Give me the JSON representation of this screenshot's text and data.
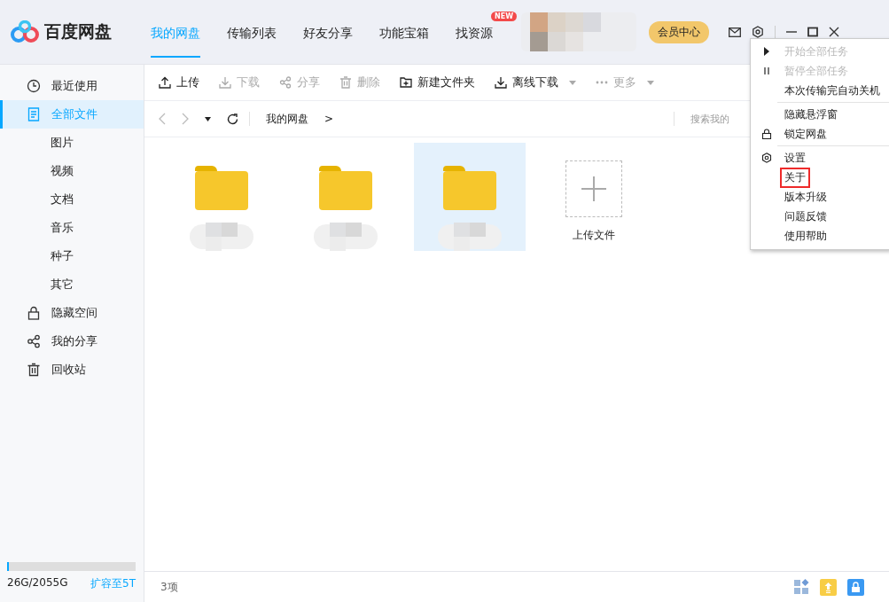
{
  "app": {
    "name": "百度网盘"
  },
  "nav_tabs": [
    {
      "label": "我的网盘",
      "selected": true
    },
    {
      "label": "传输列表",
      "selected": false
    },
    {
      "label": "好友分享",
      "selected": false
    },
    {
      "label": "功能宝箱",
      "selected": false
    },
    {
      "label": "找资源",
      "selected": false,
      "badge": "NEW"
    }
  ],
  "header": {
    "vip": "会员中心"
  },
  "sidebar": {
    "items": [
      {
        "label": "最近使用",
        "kind": "clock",
        "selected": false
      },
      {
        "label": "全部文件",
        "kind": "file",
        "selected": true,
        "children": [
          {
            "label": "图片",
            "selected": false
          },
          {
            "label": "视频",
            "selected": false
          },
          {
            "label": "文档",
            "selected": false
          },
          {
            "label": "音乐",
            "selected": false
          },
          {
            "label": "种子",
            "selected": false
          },
          {
            "label": "其它",
            "selected": false
          }
        ]
      },
      {
        "label": "隐藏空间",
        "kind": "lock",
        "selected": false
      },
      {
        "label": "我的分享",
        "kind": "share",
        "selected": false
      },
      {
        "label": "回收站",
        "kind": "trash",
        "selected": false
      }
    ]
  },
  "storage": {
    "level": 0.013,
    "usage": "26G/2055G",
    "expand": "扩容至5T"
  },
  "toolbar": [
    {
      "label": "上传",
      "kind": "upload",
      "disabled": false,
      "dropdown": false
    },
    {
      "label": "下载",
      "kind": "download",
      "disabled": true,
      "dropdown": false
    },
    {
      "label": "分享",
      "kind": "share",
      "disabled": true,
      "dropdown": false
    },
    {
      "label": "删除",
      "kind": "trash",
      "disabled": true,
      "dropdown": false
    },
    {
      "label": "新建文件夹",
      "kind": "folder",
      "disabled": false,
      "dropdown": false
    },
    {
      "label": "离线下载",
      "kind": "download",
      "disabled": false,
      "dropdown": true
    },
    {
      "label": "更多",
      "kind": "more",
      "disabled": true,
      "dropdown": true
    }
  ],
  "path": {
    "breadcrumb": "我的网盘",
    "separator": ">",
    "search_placeholder": "搜索我的"
  },
  "files": [
    {
      "selected": false
    },
    {
      "selected": false
    },
    {
      "selected": true
    }
  ],
  "upload_tile": {
    "label": "上传文件"
  },
  "status_bar": {
    "count": "3项"
  },
  "menu": {
    "sections": [
      [
        {
          "label": "开始全部任务",
          "kind": "play",
          "disabled": true,
          "highlighted": false
        },
        {
          "label": "暂停全部任务",
          "kind": "pause",
          "disabled": true,
          "highlighted": false
        },
        {
          "label": "本次传输完自动关机",
          "disabled": false,
          "highlighted": false
        }
      ],
      [
        {
          "label": "隐藏悬浮窗",
          "disabled": false,
          "highlighted": false
        },
        {
          "label": "锁定网盘",
          "kind": "lock",
          "disabled": false,
          "highlighted": false
        }
      ],
      [
        {
          "label": "设置",
          "kind": "gear",
          "disabled": false,
          "highlighted": false
        },
        {
          "label": "关于",
          "disabled": false,
          "highlighted": true
        },
        {
          "label": "版本升级",
          "disabled": false,
          "highlighted": false
        },
        {
          "label": "问题反馈",
          "disabled": false,
          "highlighted": false
        },
        {
          "label": "使用帮助",
          "disabled": false,
          "highlighted": false
        }
      ]
    ]
  }
}
